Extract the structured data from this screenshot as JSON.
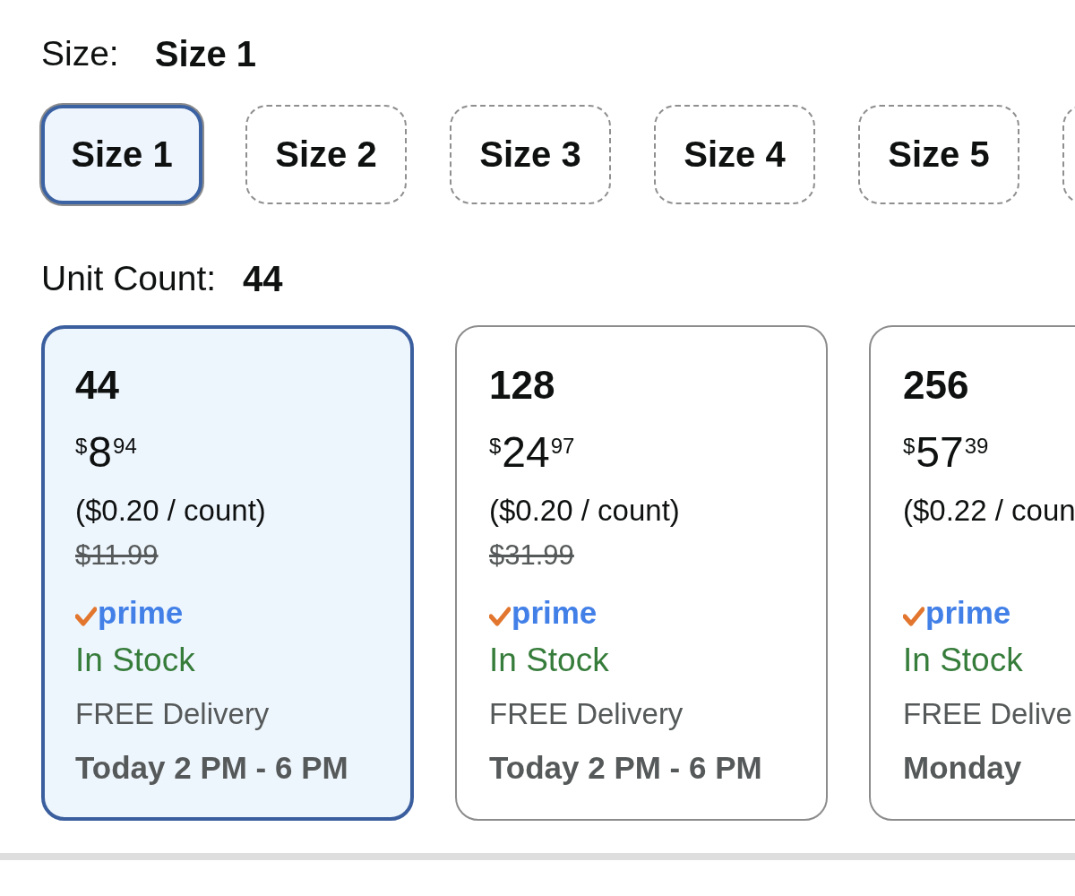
{
  "size": {
    "label": "Size:",
    "value": "Size 1",
    "options": [
      {
        "label": "Size 1",
        "selected": true
      },
      {
        "label": "Size 2",
        "selected": false
      },
      {
        "label": "Size 3",
        "selected": false
      },
      {
        "label": "Size 4",
        "selected": false
      },
      {
        "label": "Size 5",
        "selected": false
      },
      {
        "selected": false
      }
    ]
  },
  "unit_count": {
    "label": "Unit Count:",
    "value": "44",
    "options": [
      {
        "count": "44",
        "price": {
          "symbol": "$",
          "whole": "8",
          "fraction": "94"
        },
        "unit_price": "($0.20 / count)",
        "list_price": "$11.99",
        "badge": "prime",
        "stock": "In Stock",
        "delivery": "FREE Delivery",
        "delivery_time": "Today 2 PM - 6 PM",
        "selected": true
      },
      {
        "count": "128",
        "price": {
          "symbol": "$",
          "whole": "24",
          "fraction": "97"
        },
        "unit_price": "($0.20 / count)",
        "list_price": "$31.99",
        "badge": "prime",
        "stock": "In Stock",
        "delivery": "FREE Delivery",
        "delivery_time": "Today 2 PM - 6 PM",
        "selected": false
      },
      {
        "count": "256",
        "price": {
          "symbol": "$",
          "whole": "57",
          "fraction": "39"
        },
        "unit_price": "($0.22 / coun",
        "badge": "prime",
        "stock": "In Stock",
        "delivery": "FREE Delive",
        "delivery_time": "Monday",
        "selected": false
      }
    ]
  }
}
